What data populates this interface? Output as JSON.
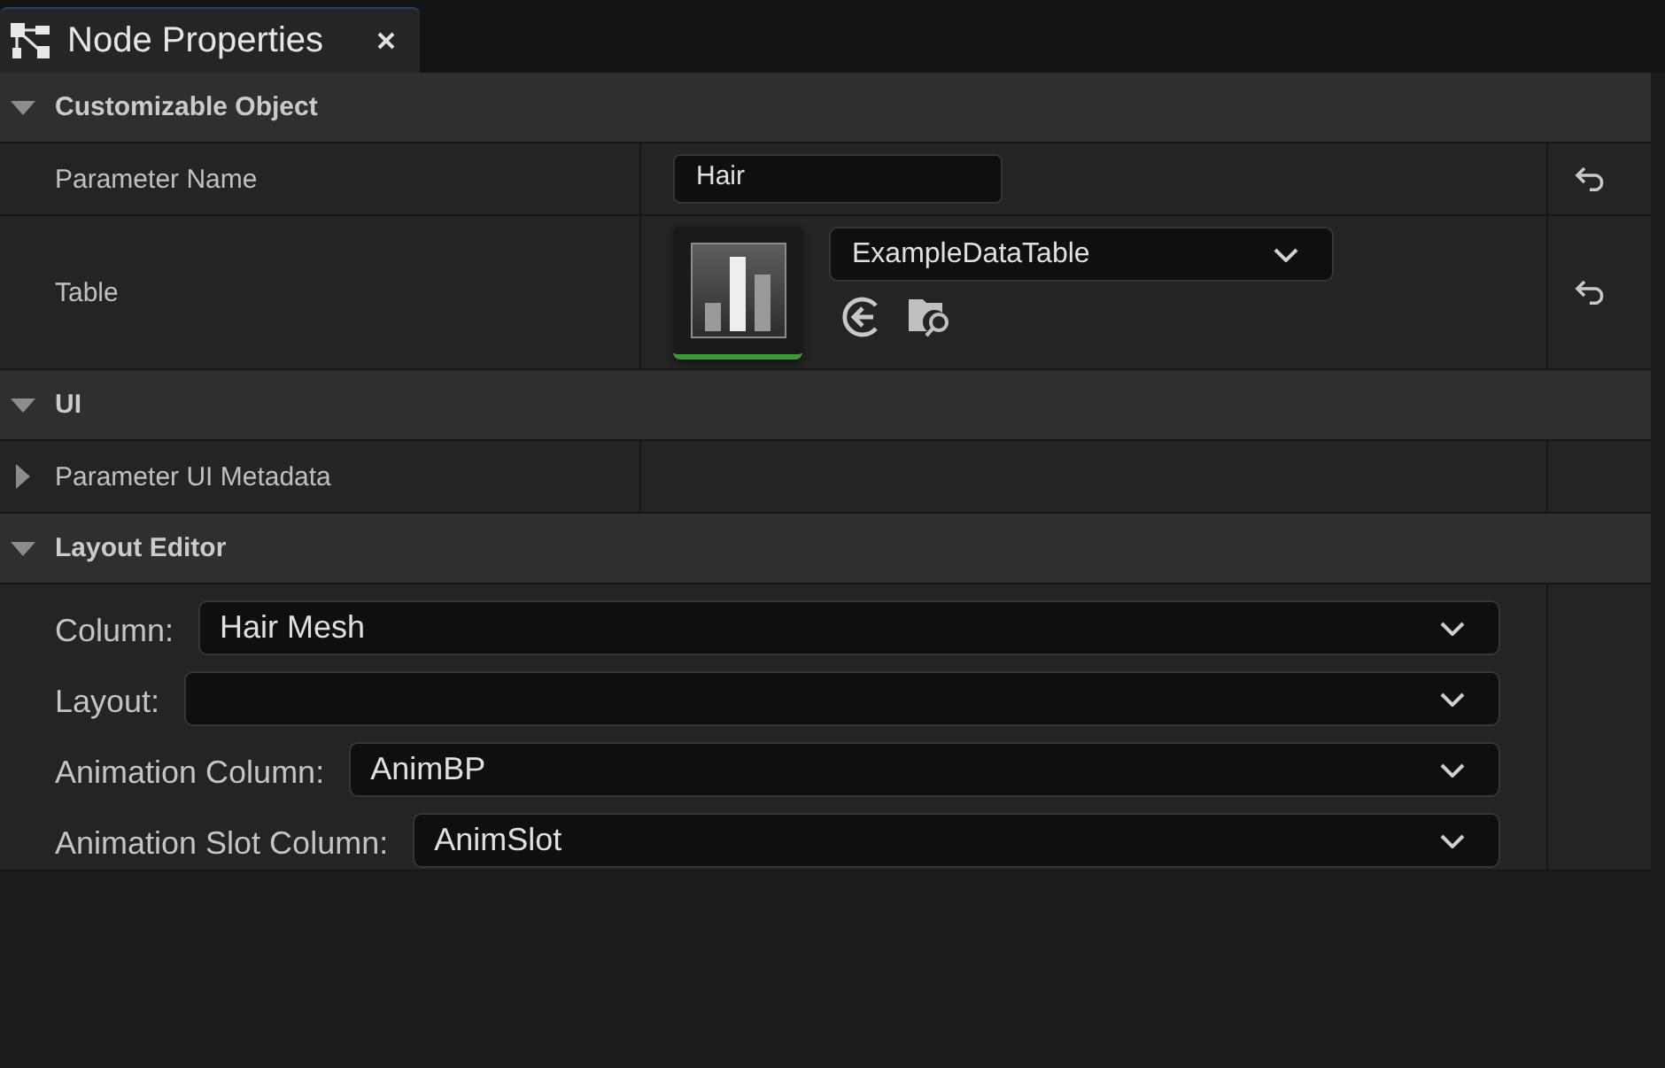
{
  "tab": {
    "title": "Node Properties"
  },
  "sections": [
    {
      "title": "Customizable Object",
      "expanded": true,
      "kind": "properties",
      "rows": [
        {
          "kind": "text",
          "label": "Parameter Name",
          "value": "Hair",
          "resettable": true
        },
        {
          "kind": "asset",
          "label": "Table",
          "value": "ExampleDataTable",
          "resettable": true
        }
      ]
    },
    {
      "title": "UI",
      "expanded": true,
      "kind": "properties",
      "rows": [
        {
          "kind": "group",
          "label": "Parameter UI Metadata",
          "expanded": false,
          "resettable": false
        }
      ]
    },
    {
      "title": "Layout Editor",
      "expanded": true,
      "kind": "layout",
      "fields": [
        {
          "label": "Column:",
          "value": "Hair Mesh"
        },
        {
          "label": "Layout:"
        },
        {
          "label": "Animation Column:",
          "value": "AnimBP"
        },
        {
          "label": "Animation Slot Column:",
          "value": "AnimSlot"
        }
      ]
    }
  ]
}
